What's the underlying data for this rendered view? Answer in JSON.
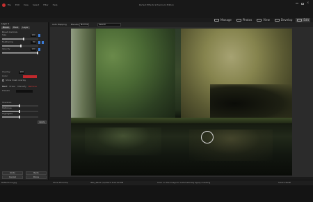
{
  "app": {
    "window_title": "Perfect Effects 9 Premium Edition",
    "menu": [
      "File",
      "Edit",
      "View",
      "Select",
      "Filter",
      "Help"
    ]
  },
  "modules": [
    {
      "label": "Manage",
      "active": false
    },
    {
      "label": "Photos",
      "active": false
    },
    {
      "label": "View",
      "active": false
    },
    {
      "label": "Develop",
      "active": false
    },
    {
      "label": "Edit",
      "active": true
    }
  ],
  "left_panel": {
    "title": "Layer 1",
    "tabs": [
      "Brush",
      "Mask",
      "Layer"
    ],
    "brush_section": "Brush Controls",
    "rows": [
      {
        "label": "Size",
        "value": "150"
      },
      {
        "label": "Feathering",
        "value": "50"
      },
      {
        "label": "Opacity",
        "value": "100"
      }
    ],
    "flow_label": "Overlay",
    "flow_value": "100",
    "color_label": "Color",
    "show_mask_label": "Show mask overlay",
    "modes": [
      "Paint",
      "Erase",
      "Intensify",
      "Remove"
    ],
    "preset_label": "Presets",
    "adjust_rows": [
      {
        "label": "Shadows"
      },
      {
        "label": "Midtones"
      },
      {
        "label": "Highlights"
      }
    ],
    "apply_label": "Apply",
    "bottom_buttons": [
      {
        "left": "Undo",
        "right": "Redo"
      },
      {
        "left": "Cancel",
        "right": "Done"
      }
    ]
  },
  "toolbar": {
    "zoom_label": "Auto Mapping",
    "blending_label": "Blending",
    "blending_value": "Normal",
    "search_placeholder": "Search"
  },
  "status": {
    "panel_label": "Show Filmstrip",
    "hint": "Click on the image to automatically apply masking",
    "file_info": "IMG_4824 7/4/2015 3:04:00 PM",
    "size": "5472×3648",
    "filename": "Reflections.jpg"
  }
}
